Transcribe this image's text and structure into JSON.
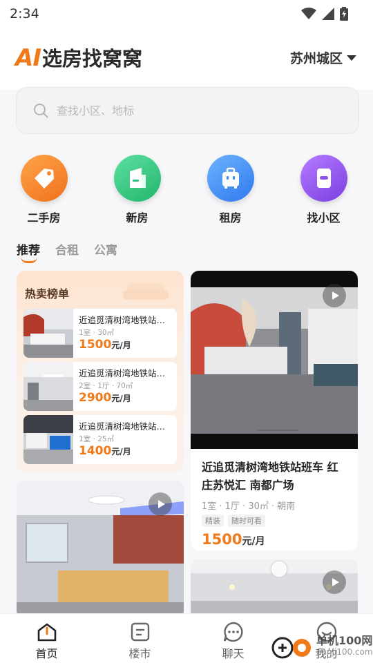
{
  "status_bar": {
    "time": "2:34"
  },
  "header": {
    "logo_ai": "AI",
    "logo_text": "选房找窝窝",
    "city": "苏州城区"
  },
  "search": {
    "placeholder": "查找小区、地标"
  },
  "categories": [
    {
      "label": "二手房",
      "icon": "tag-icon",
      "color": "#f58a2b"
    },
    {
      "label": "新房",
      "icon": "building-icon",
      "color": "#2ec27e"
    },
    {
      "label": "租房",
      "icon": "suitcase-icon",
      "color": "#3b8cf5"
    },
    {
      "label": "找小区",
      "icon": "community-icon",
      "color": "#8b52e8"
    }
  ],
  "tabs": [
    {
      "label": "推荐",
      "active": true
    },
    {
      "label": "合租",
      "active": false
    },
    {
      "label": "公寓",
      "active": false
    }
  ],
  "hot_list": {
    "title": "热卖榜单",
    "items": [
      {
        "name": "近追觅清树湾地铁站班车 红庄苏悦汇",
        "spec": "1室 · 30㎡",
        "price": "1500",
        "unit": "元/月"
      },
      {
        "name": "近追觅清树湾地铁站班车 红庄苏悦汇",
        "spec": "2室 · 1厅 · 70㎡",
        "price": "2900",
        "unit": "元/月"
      },
      {
        "name": "近追觅清树湾地铁站班车 红庄苏悦汇",
        "spec": "1室 · 25㎡",
        "price": "1400",
        "unit": "元/月"
      }
    ]
  },
  "featured_card": {
    "title": "近追觅清树湾地铁站班车 红庄苏悦汇 南都广场",
    "spec": "1室 · 1厅 · 30㎡ · 朝南",
    "tags": [
      "精装",
      "随时可看"
    ],
    "price": "1500",
    "unit": "元/月"
  },
  "bottom_nav": [
    {
      "label": "首页",
      "icon": "home-icon",
      "active": true
    },
    {
      "label": "楼市",
      "icon": "news-icon",
      "active": false
    },
    {
      "label": "聊天",
      "icon": "chat-icon",
      "active": false
    },
    {
      "label": "我的",
      "icon": "profile-icon",
      "active": false
    }
  ],
  "watermark": {
    "title": "单机100网",
    "url": "danji100.com"
  },
  "colors": {
    "accent": "#f07a1a",
    "background": "#f7f7f9"
  }
}
